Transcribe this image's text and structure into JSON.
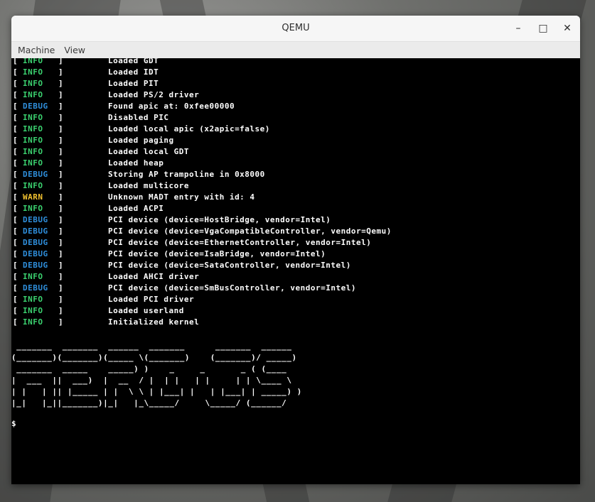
{
  "window": {
    "title": "QEMU",
    "minimize_glyph": "–",
    "maximize_glyph": "□",
    "close_glyph": "✕"
  },
  "menu": [
    "Machine",
    "View"
  ],
  "colors": {
    "INFO": "#3bd16f",
    "DEBUG": "#2f8fdc",
    "WARN": "#f2c230",
    "bracket": "#ffffff"
  },
  "log": [
    {
      "level": "INFO",
      "message": "Loaded GDT"
    },
    {
      "level": "INFO",
      "message": "Loaded IDT"
    },
    {
      "level": "INFO",
      "message": "Loaded PIT"
    },
    {
      "level": "INFO",
      "message": "Loaded PS/2 driver"
    },
    {
      "level": "DEBUG",
      "message": "Found apic at: 0xfee00000"
    },
    {
      "level": "INFO",
      "message": "Disabled PIC"
    },
    {
      "level": "INFO",
      "message": "Loaded local apic (x2apic=false)"
    },
    {
      "level": "INFO",
      "message": "Loaded paging"
    },
    {
      "level": "INFO",
      "message": "Loaded local GDT"
    },
    {
      "level": "INFO",
      "message": "Loaded heap"
    },
    {
      "level": "DEBUG",
      "message": "Storing AP trampoline in 0x8000"
    },
    {
      "level": "INFO",
      "message": "Loaded multicore"
    },
    {
      "level": "WARN",
      "message": "Unknown MADT entry with id: 4"
    },
    {
      "level": "INFO",
      "message": "Loaded ACPI"
    },
    {
      "level": "DEBUG",
      "message": "PCI device (device=HostBridge, vendor=Intel)"
    },
    {
      "level": "DEBUG",
      "message": "PCI device (device=VgaCompatibleController, vendor=Qemu)"
    },
    {
      "level": "DEBUG",
      "message": "PCI device (device=EthernetController, vendor=Intel)"
    },
    {
      "level": "DEBUG",
      "message": "PCI device (device=IsaBridge, vendor=Intel)"
    },
    {
      "level": "DEBUG",
      "message": "PCI device (device=SataController, vendor=Intel)"
    },
    {
      "level": "INFO",
      "message": "Loaded AHCI driver"
    },
    {
      "level": "DEBUG",
      "message": "PCI device (device=SmBusController, vendor=Intel)"
    },
    {
      "level": "INFO",
      "message": "Loaded PCI driver"
    },
    {
      "level": "INFO",
      "message": "Loaded userland"
    },
    {
      "level": "INFO",
      "message": "Initialized kernel"
    }
  ],
  "ascii_art": [
    " _______  _______  ______  _______      _______  ______ ",
    "(_______)(_______)(_____ \\(_______)    (_______)/ _____)",
    " _______  _____    _____) )    _     _       _ ( (____  ",
    "|  ___  ||  ___)  |  __  / |  | |   | |     | | \\____ \\ ",
    "| |   | || |_____ | |  \\ \\ | |___| |   | |___| | _____) )",
    "|_|   |_||_______)|_|   |_\\_____/     \\_____/ (______/ "
  ],
  "prompt": "$"
}
